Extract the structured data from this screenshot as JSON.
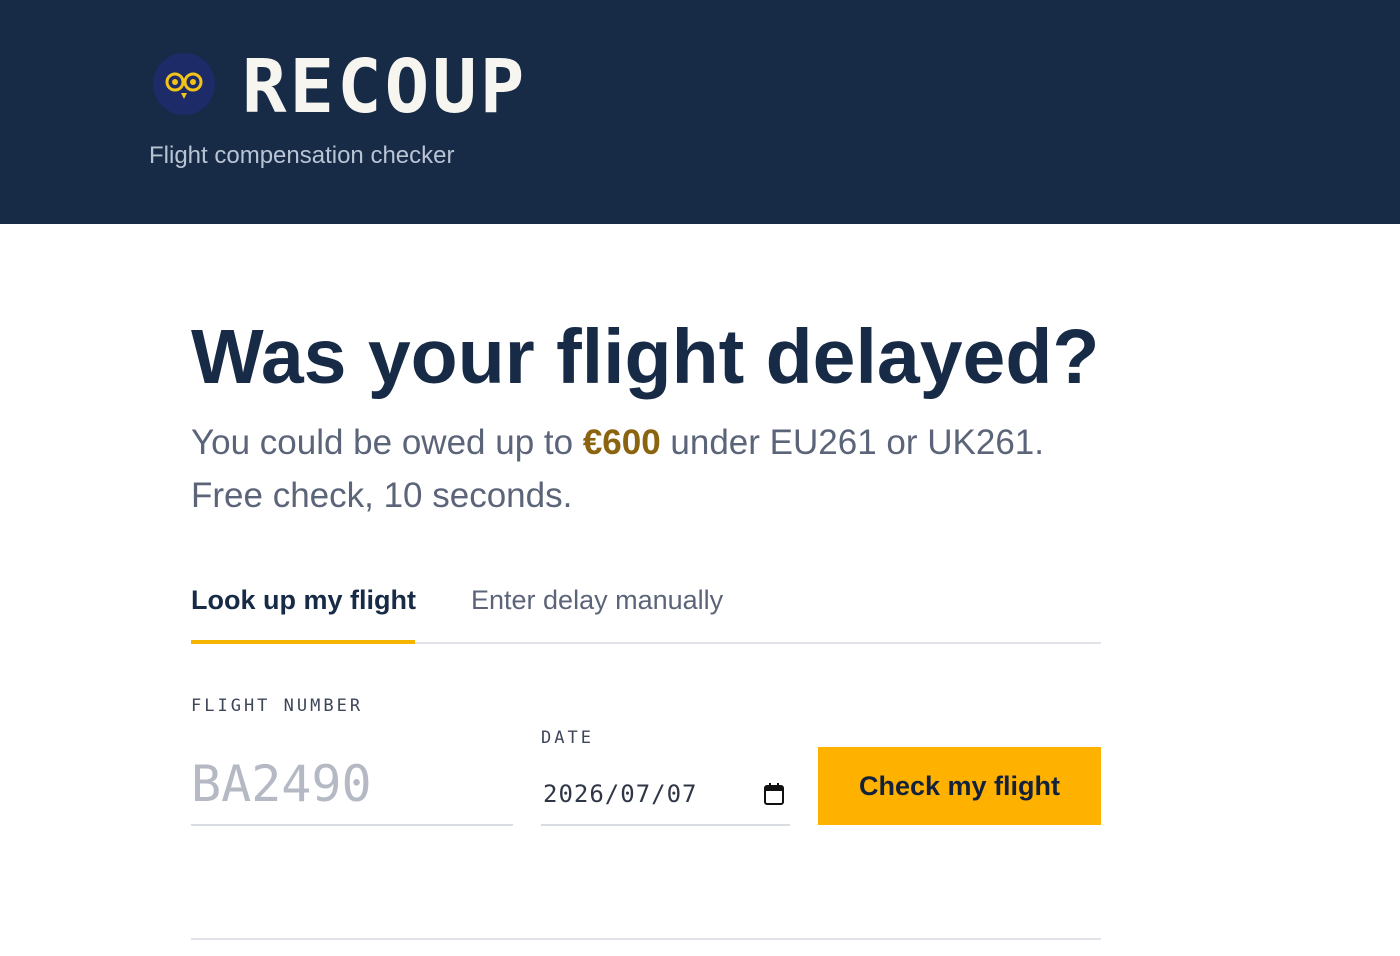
{
  "header": {
    "brand_name": "RECOUP",
    "tagline": "Flight compensation checker",
    "logo_icon": "owl-icon",
    "background_color": "#172a46"
  },
  "hero": {
    "title": "Was your flight delayed?",
    "subtitle_before": "You could be owed up to ",
    "subtitle_amount": "€600",
    "subtitle_after": " under EU261 or UK261. Free check, 10 seconds.",
    "amount_color": "#8b6410"
  },
  "tabs": [
    {
      "label": "Look up my flight",
      "active": true
    },
    {
      "label": "Enter delay manually",
      "active": false
    }
  ],
  "form": {
    "flight_number_label": "FLIGHT NUMBER",
    "flight_number_value": "",
    "flight_number_placeholder": "BA2490",
    "date_label": "DATE",
    "date_value": "2026/07/07",
    "date_icon": "calendar-icon",
    "submit_label": "Check my flight",
    "accent_color": "#ffb100"
  }
}
